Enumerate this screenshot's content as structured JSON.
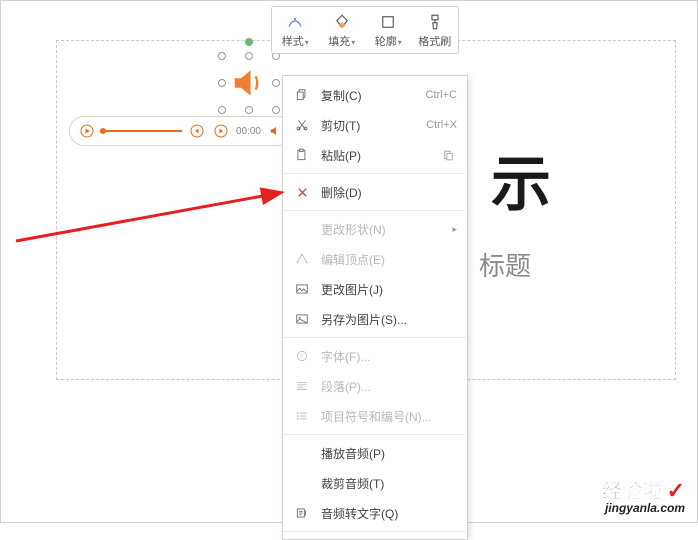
{
  "slide": {
    "title": "示",
    "subtitle": "标题"
  },
  "audio": {
    "time": "00:00"
  },
  "toolbar": {
    "style": "样式",
    "fill": "填充",
    "outline": "轮廓",
    "formatPainter": "格式刷"
  },
  "menu": {
    "copy": {
      "label": "复制(C)",
      "shortcut": "Ctrl+C"
    },
    "cut": {
      "label": "剪切(T)",
      "shortcut": "Ctrl+X"
    },
    "paste": {
      "label": "粘贴(P)"
    },
    "delete": {
      "label": "删除(D)"
    },
    "changeShape": {
      "label": "更改形状(N)"
    },
    "editPoints": {
      "label": "编辑顶点(E)"
    },
    "changePicture": {
      "label": "更改图片(J)"
    },
    "saveAsPicture": {
      "label": "另存为图片(S)..."
    },
    "font": {
      "label": "字体(F)..."
    },
    "paragraph": {
      "label": "段落(P)..."
    },
    "bullets": {
      "label": "项目符号和编号(N)..."
    },
    "playAudio": {
      "label": "播放音频(P)"
    },
    "trimAudio": {
      "label": "裁剪音频(T)"
    },
    "audioToText": {
      "label": "音频转文字(Q)"
    }
  },
  "watermark": {
    "line1": "经验啦",
    "line2": "jingyanla.com"
  }
}
